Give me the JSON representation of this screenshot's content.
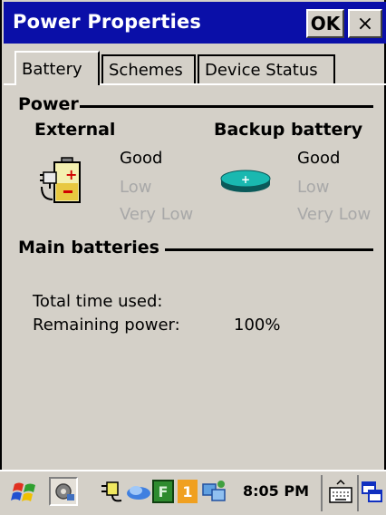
{
  "window": {
    "title": "Power Properties",
    "ok_label": "OK",
    "close_label": "×"
  },
  "tabs": [
    {
      "label": "Battery",
      "selected": true
    },
    {
      "label": "Schemes",
      "selected": false
    },
    {
      "label": "Device Status",
      "selected": false
    }
  ],
  "power": {
    "section_label": "Power",
    "external": {
      "heading": "External",
      "icon": "battery-plug-icon",
      "levels": [
        "Good",
        "Low",
        "Very Low"
      ]
    },
    "backup": {
      "heading": "Backup battery",
      "icon": "coin-cell-battery-icon",
      "levels": [
        "Good",
        "Low",
        "Very Low"
      ]
    }
  },
  "main_batteries": {
    "section_label": "Main batteries",
    "total_time_label": "Total time used:",
    "remaining_label": "Remaining power:",
    "remaining_value": "100%"
  },
  "taskbar": {
    "start_icon": "windows-flag-icon",
    "clock": "8:05 PM",
    "tray_icons": [
      "power-plug-icon",
      "network-icon",
      "f-indicator-icon",
      "one-indicator-icon",
      "sync-icon",
      "keyboard-icon",
      "window-switch-icon"
    ],
    "colors": {
      "title_bar": "#0a0fa8",
      "f_badge": "#2e8b2e",
      "one_badge": "#f0a020"
    }
  }
}
